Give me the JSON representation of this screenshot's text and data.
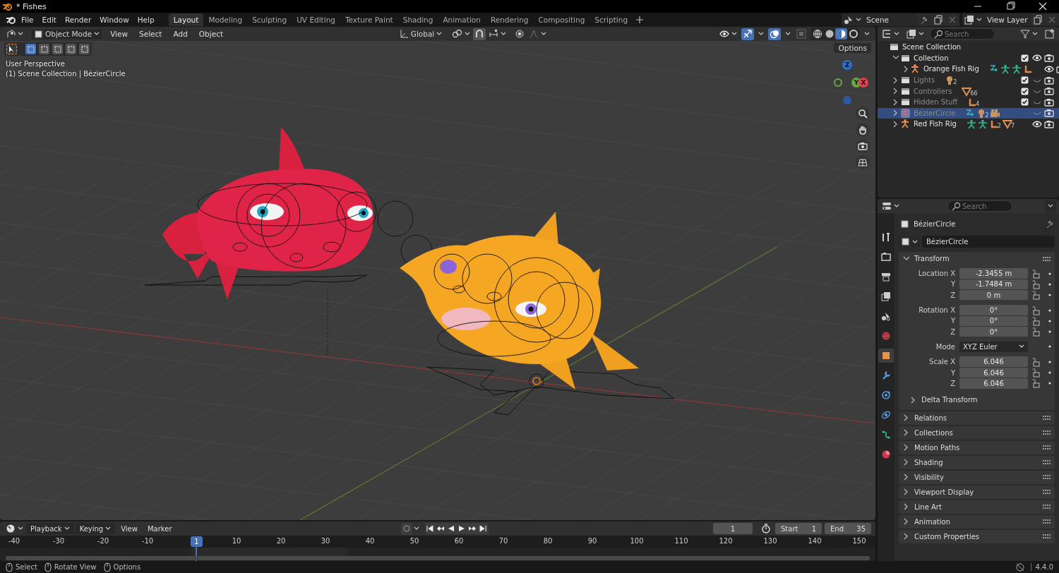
{
  "window": {
    "title": "* Fishes"
  },
  "menu": [
    "File",
    "Edit",
    "Render",
    "Window",
    "Help"
  ],
  "workspaces": [
    {
      "label": "Layout",
      "selected": true
    },
    {
      "label": "Modeling",
      "selected": false
    },
    {
      "label": "Sculpting",
      "selected": false
    },
    {
      "label": "UV Editing",
      "selected": false
    },
    {
      "label": "Texture Paint",
      "selected": false
    },
    {
      "label": "Shading",
      "selected": false
    },
    {
      "label": "Animation",
      "selected": false
    },
    {
      "label": "Rendering",
      "selected": false
    },
    {
      "label": "Compositing",
      "selected": false
    },
    {
      "label": "Scripting",
      "selected": false
    }
  ],
  "scene": {
    "name": "Scene"
  },
  "view_layer": {
    "name": "View Layer"
  },
  "viewport": {
    "mode": "Object Mode",
    "menus": [
      "View",
      "Select",
      "Add",
      "Object"
    ],
    "orientation": "Global",
    "toggles": [
      {
        "kind": "gizmo",
        "on": true
      },
      {
        "kind": "overlay",
        "on": true
      },
      {
        "kind": "xray",
        "on": false
      }
    ],
    "shading": [
      {
        "kind": "wireframe",
        "selected": false
      },
      {
        "kind": "solid",
        "selected": false
      },
      {
        "kind": "material",
        "selected": true
      },
      {
        "kind": "rendered",
        "selected": false
      }
    ],
    "select_modes": [
      {
        "selected": true
      },
      {
        "selected": false
      },
      {
        "selected": false
      },
      {
        "selected": false
      },
      {
        "selected": false
      }
    ],
    "options": "Options",
    "overlay_text": [
      "User Perspective",
      "(1) Scene Collection | BézierCircle"
    ],
    "gizmo_axes": [
      "Z",
      "Y",
      "X"
    ]
  },
  "outliner": {
    "search": {
      "placeholder": "Search"
    },
    "tree": {
      "name": "Scene Collection",
      "kind": "scene_collection",
      "selected": false,
      "children": [
        {
          "name": "Collection",
          "kind": "collection",
          "expanded": true,
          "checked": true,
          "visible": true,
          "selected": false,
          "children": [
            {
              "name": "Orange Fish Rig",
              "kind": "armature",
              "expanded": false,
              "visible": true,
              "selected": false,
              "data_icons": [
                {
                  "kind": "constraint"
                },
                {
                  "kind": "pose"
                },
                {
                  "kind": "pose"
                },
                {
                  "kind": "bone"
                }
              ]
            }
          ]
        },
        {
          "name": "Lights",
          "kind": "collection",
          "expanded": false,
          "checked": true,
          "visible": false,
          "selected": false,
          "data_icons": [
            {
              "kind": "light",
              "count": "2"
            }
          ]
        },
        {
          "name": "Controllers",
          "kind": "collection",
          "expanded": false,
          "checked": true,
          "visible": false,
          "selected": false,
          "data_icons": [
            {
              "kind": "mesh",
              "count": "66"
            }
          ]
        },
        {
          "name": "Hidden Stuff",
          "kind": "collection",
          "expanded": false,
          "checked": true,
          "visible": false,
          "selected": false,
          "data_icons": [
            {
              "kind": "bone",
              "count": "4"
            }
          ]
        },
        {
          "name": "BézierCircle",
          "kind": "curve",
          "expanded": false,
          "visible": false,
          "selected": true,
          "data_icons": [
            {
              "kind": "constraint"
            },
            {
              "kind": "light",
              "count": "2"
            },
            {
              "kind": "camera"
            }
          ]
        },
        {
          "name": "Red Fish Rig",
          "kind": "armature",
          "expanded": false,
          "visible": true,
          "selected": false,
          "data_icons": [
            {
              "kind": "pose"
            },
            {
              "kind": "pose"
            },
            {
              "kind": "bone",
              "count": "2"
            },
            {
              "kind": "mesh",
              "count": "7"
            }
          ]
        }
      ]
    }
  },
  "properties": {
    "search": {
      "placeholder": "Search"
    },
    "tabs": [
      {
        "kind": "tool",
        "selected": false
      },
      {
        "kind": "render",
        "selected": false
      },
      {
        "kind": "output",
        "selected": false
      },
      {
        "kind": "view_layer",
        "selected": false
      },
      {
        "kind": "scene",
        "selected": false
      },
      {
        "kind": "world",
        "selected": false
      },
      {
        "kind": "object",
        "selected": true
      },
      {
        "kind": "modifier",
        "selected": false
      },
      {
        "kind": "particles",
        "selected": false
      },
      {
        "kind": "physics",
        "selected": false
      },
      {
        "kind": "data",
        "selected": false
      },
      {
        "kind": "material",
        "selected": false
      }
    ],
    "object_name": "BézierCircle",
    "name_field": "BézierCircle",
    "transform": {
      "title": "Transform",
      "expanded": true,
      "groups": [
        [
          {
            "label": "Location X",
            "value": "-2.3455 m",
            "kind": "number",
            "locked": false
          },
          {
            "label": "Y",
            "value": "-1.7484 m",
            "kind": "number",
            "locked": false
          },
          {
            "label": "Z",
            "value": "0 m",
            "kind": "number",
            "locked": false
          }
        ],
        [
          {
            "label": "Rotation X",
            "value": "0°",
            "kind": "number",
            "locked": false
          },
          {
            "label": "Y",
            "value": "0°",
            "kind": "number",
            "locked": false
          },
          {
            "label": "Z",
            "value": "0°",
            "kind": "number",
            "locked": false
          }
        ],
        [
          {
            "label": "Mode",
            "value": "XYZ Euler",
            "kind": "dropdown"
          }
        ],
        [
          {
            "label": "Scale X",
            "value": "6.046",
            "kind": "number",
            "locked": false
          },
          {
            "label": "Y",
            "value": "6.046",
            "kind": "number",
            "locked": false
          },
          {
            "label": "Z",
            "value": "6.046",
            "kind": "number",
            "locked": false
          }
        ]
      ],
      "subpanels": [
        {
          "title": "Delta Transform",
          "expanded": false
        }
      ]
    },
    "panels": [
      {
        "title": "Relations",
        "expanded": false
      },
      {
        "title": "Collections",
        "expanded": false
      },
      {
        "title": "Motion Paths",
        "expanded": false
      },
      {
        "title": "Shading",
        "expanded": false
      },
      {
        "title": "Visibility",
        "expanded": false
      },
      {
        "title": "Viewport Display",
        "expanded": false
      },
      {
        "title": "Line Art",
        "expanded": false
      },
      {
        "title": "Animation",
        "expanded": false
      },
      {
        "title": "Custom Properties",
        "expanded": false
      }
    ]
  },
  "timeline": {
    "menus": [
      {
        "label": "Playback",
        "kind": "dropdown"
      },
      {
        "label": "Keying",
        "kind": "dropdown"
      },
      {
        "label": "View",
        "kind": "menu"
      },
      {
        "label": "Marker",
        "kind": "menu"
      }
    ],
    "current_frame": "1",
    "start": {
      "label": "Start",
      "value": "1"
    },
    "end": {
      "label": "End",
      "value": "35"
    },
    "ruler": [
      "-40",
      "-30",
      "-20",
      "-10",
      "10",
      "20",
      "30",
      "40",
      "50",
      "60",
      "70",
      "80",
      "90",
      "100",
      "110",
      "120",
      "130",
      "140",
      "150"
    ],
    "playhead": "1"
  },
  "status_bar": {
    "hints": [
      "Select",
      "Rotate View",
      "Options"
    ],
    "version": "4.4.0"
  }
}
